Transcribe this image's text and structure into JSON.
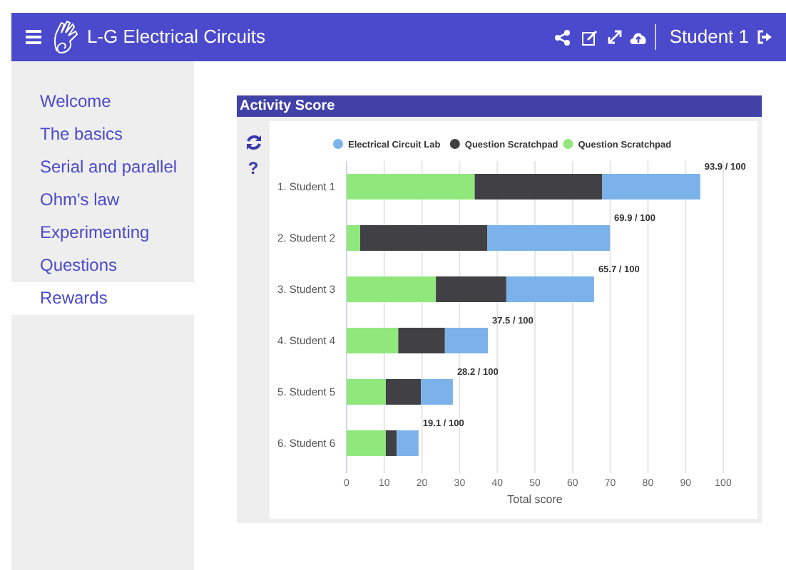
{
  "header": {
    "title": "L-G Electrical Circuits",
    "user": "Student 1"
  },
  "sidebar": {
    "items": [
      {
        "label": "Welcome",
        "selected": false
      },
      {
        "label": "The basics",
        "selected": false
      },
      {
        "label": "Serial and parallel",
        "selected": false
      },
      {
        "label": "Ohm's law",
        "selected": false
      },
      {
        "label": "Experimenting",
        "selected": false
      },
      {
        "label": "Questions",
        "selected": false
      },
      {
        "label": "Rewards",
        "selected": true
      }
    ]
  },
  "panel": {
    "title": "Activity Score",
    "tools": [
      "?"
    ],
    "chart_data": {
      "type": "bar",
      "orientation": "horizontal",
      "stacked": true,
      "xlabel": "Total score",
      "categories": [
        "1. Student 1",
        "2. Student 2",
        "3. Student 3",
        "4. Student 4",
        "5. Student 5",
        "6. Student 6"
      ],
      "series": [
        {
          "name": "Electrical Circuit Lab",
          "color": "#7cb2ea",
          "values": [
            26.0,
            32.5,
            23.3,
            11.4,
            8.5,
            5.8
          ]
        },
        {
          "name": "Question Scratchpad",
          "color": "#414045",
          "values": [
            33.9,
            33.8,
            18.7,
            12.4,
            9.3,
            2.9
          ]
        },
        {
          "name": "Question Scratchpad",
          "color": "#90e87c",
          "values": [
            34.0,
            3.6,
            23.7,
            13.7,
            10.4,
            10.4
          ]
        }
      ],
      "legend": true,
      "grid": true,
      "xlim": [
        0,
        100
      ],
      "xticks": [
        0,
        10,
        20,
        30,
        40,
        50,
        60,
        70,
        80,
        90,
        100
      ],
      "value_labels": [
        "93.9 / 100",
        "69.9 / 100",
        "65.7 / 100",
        "37.5 / 100",
        "28.2 / 100",
        "19.1 / 100"
      ]
    }
  }
}
